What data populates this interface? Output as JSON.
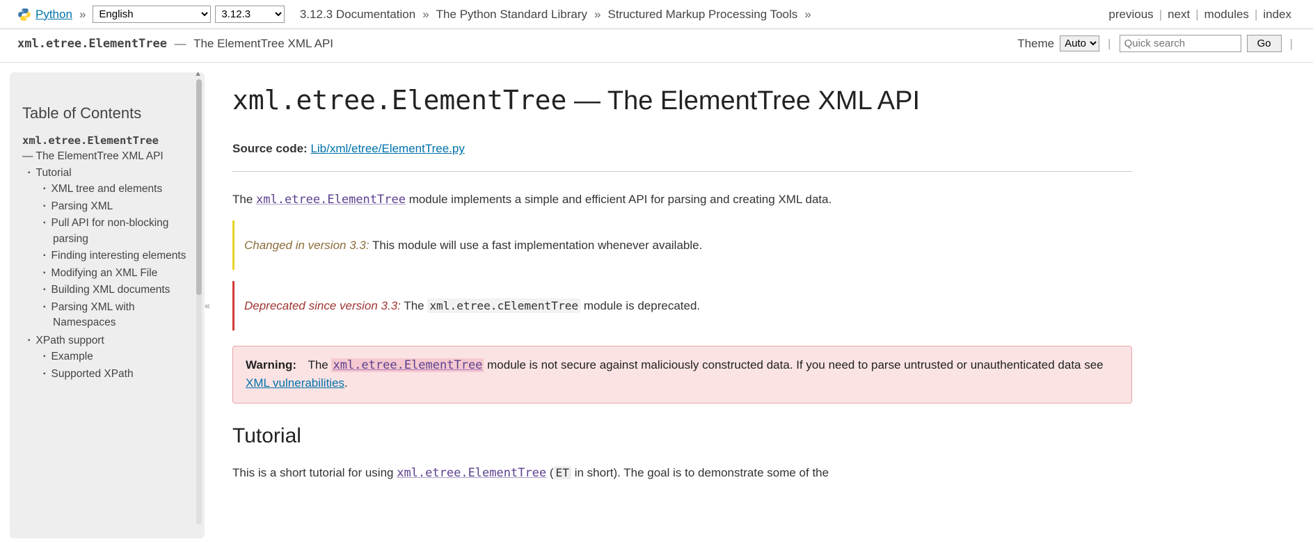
{
  "topbar": {
    "brand": "Python",
    "language": "English",
    "version": "3.12.3",
    "breadcrumbs": [
      "3.12.3 Documentation",
      "The Python Standard Library",
      "Structured Markup Processing Tools"
    ],
    "nav": {
      "previous": "previous",
      "next": "next",
      "modules": "modules",
      "index": "index"
    }
  },
  "subbar": {
    "module": "xml.etree.ElementTree",
    "subtitle": "The ElementTree XML API",
    "theme_label": "Theme",
    "theme_value": "Auto",
    "search_placeholder": "Quick search",
    "go": "Go"
  },
  "toc": {
    "title": "Table of Contents",
    "root_module": "xml.etree.ElementTree",
    "root_desc": "— The ElementTree XML API",
    "items": [
      {
        "label": "Tutorial",
        "children": [
          "XML tree and elements",
          "Parsing XML",
          "Pull API for non-blocking parsing",
          "Finding interesting elements",
          "Modifying an XML File",
          "Building XML documents",
          "Parsing XML with Namespaces"
        ]
      },
      {
        "label": "XPath support",
        "children": [
          "Example",
          "Supported XPath"
        ]
      }
    ]
  },
  "page": {
    "title_module": "xml.etree.ElementTree",
    "title_rest": " — The ElementTree XML API",
    "source_label": "Source code:",
    "source_link": "Lib/xml/etree/ElementTree.py",
    "intro_pre": "The ",
    "intro_mod": "xml.etree.ElementTree",
    "intro_post": " module implements a simple and efficient API for parsing and creating XML data.",
    "changed_label": "Changed in version 3.3:",
    "changed_text": " This module will use a fast implementation whenever available.",
    "deprecated_label": "Deprecated since version 3.3:",
    "deprecated_pre": " The ",
    "deprecated_mod": "xml.etree.cElementTree",
    "deprecated_post": " module is deprecated.",
    "warning_label": "Warning:",
    "warning_pre": "The ",
    "warning_mod": "xml.etree.ElementTree",
    "warning_mid": " module is not secure against maliciously constructed data. If you need to parse untrusted or unauthenticated data see ",
    "warning_link": "XML vulnerabilities",
    "warning_end": ".",
    "tutorial_heading": "Tutorial",
    "tutorial_pre": "This is a short tutorial for using ",
    "tutorial_mod": "xml.etree.ElementTree",
    "tutorial_mid": " (",
    "tutorial_abbr": "ET",
    "tutorial_post": " in short). The goal is to demonstrate some of the"
  }
}
